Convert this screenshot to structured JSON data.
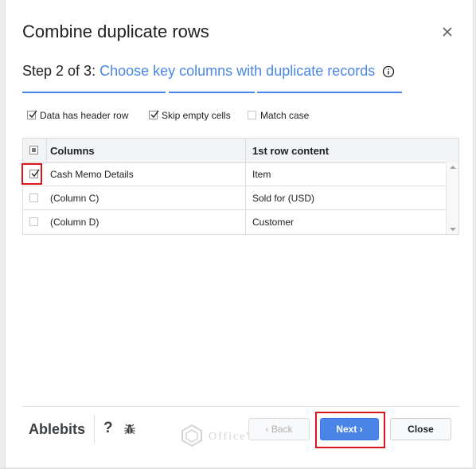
{
  "dialog": {
    "title": "Combine duplicate rows",
    "close_icon": "close-icon"
  },
  "step": {
    "prefix": "Step 2 of 3:",
    "title": "Choose key columns with duplicate records",
    "info_icon": "info-icon"
  },
  "options": [
    {
      "label": "Data has header row",
      "checked": true
    },
    {
      "label": "Skip empty cells",
      "checked": true
    },
    {
      "label": "Match case",
      "checked": false
    }
  ],
  "table": {
    "headers": [
      "Columns",
      "1st row content"
    ],
    "rows": [
      {
        "column": "Cash Memo Details",
        "content": "Item",
        "checked": true
      },
      {
        "column": "(Column C)",
        "content": "Sold for (USD)",
        "checked": false
      },
      {
        "column": "(Column D)",
        "content": "Customer",
        "checked": false
      }
    ]
  },
  "footer": {
    "brand": "Ablebits",
    "help_label": "?",
    "bug_icon": "bug-icon",
    "watermark": "OfficeWheel",
    "back_label": "‹ Back",
    "next_label": "Next ›",
    "close_label": "Close"
  },
  "colors": {
    "accent": "#4a86e8",
    "highlight": "#e0151c"
  }
}
